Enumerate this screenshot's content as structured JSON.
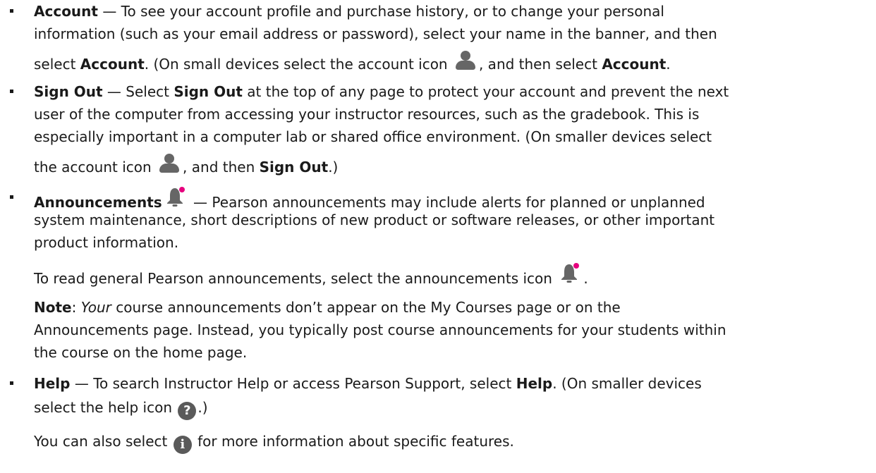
{
  "icons": {
    "account": "account-icon",
    "announcements": "bell-icon",
    "help": "help-icon",
    "info": "info-icon",
    "help_glyph": "?",
    "info_glyph": "i"
  },
  "colors": {
    "icon_gray": "#666666",
    "notification_dot": "#e6007e"
  },
  "items": {
    "account": {
      "title": "Account",
      "t1": " — To see your account profile and purchase history, or to change your personal",
      "t2": "information (such as your email address or password), select your name in the banner, and then",
      "t3a": "select ",
      "t3b": "Account",
      "t3c": ". (On small devices select the account icon ",
      "t3d": ", and then select ",
      "t3e": "Account",
      "t3f": "."
    },
    "sign_out": {
      "title": "Sign Out",
      "t1a": " — Select ",
      "t1b": "Sign Out",
      "t1c": " at the top of any page to protect your account and prevent the next",
      "t2": "user of the computer from accessing your instructor resources, such as the gradebook. This is",
      "t3": "especially important in a computer lab or shared office environment. (On smaller devices select",
      "t4a": "the account icon ",
      "t4b": ", and then ",
      "t4c": "Sign Out",
      "t4d": ".)"
    },
    "announcements": {
      "title": "Announcements",
      "t1": " — Pearson announcements may include alerts for planned or unplanned",
      "t2": "system maintenance, short descriptions of new product or software releases, or other important",
      "t3": "product information.",
      "p2": "To read general Pearson announcements, select the announcements icon ",
      "p2_end": ".",
      "note_label": "Note",
      "note_colon": ": ",
      "note_italic": "Your",
      "note_t1": " course announcements don’t appear on the My Courses page or on the",
      "note_t2": "Announcements page. Instead, you typically post course announcements for your students within",
      "note_t3": "the course on the home page."
    },
    "help": {
      "title": "Help",
      "t1a": " — To search Instructor Help or access Pearson Support, select ",
      "t1b": "Help",
      "t1c": ". (On smaller devices",
      "t2a": "select the help icon ",
      "t2b": ".)",
      "p2a": "You can also select ",
      "p2b": " for more information about specific features."
    }
  }
}
